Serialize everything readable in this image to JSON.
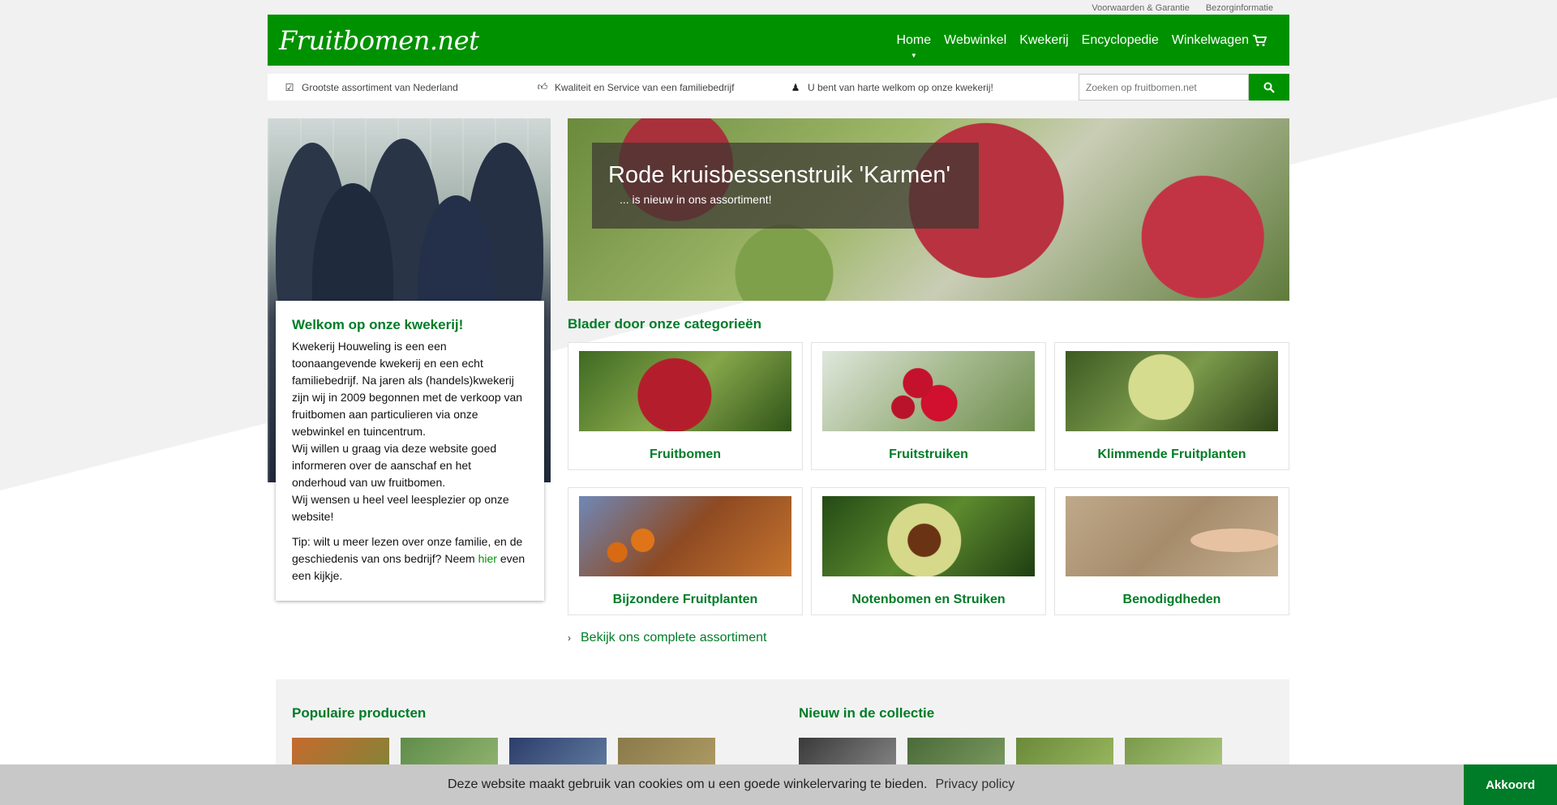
{
  "toplinks": [
    "Voorwaarden & Garantie",
    "Bezorginformatie"
  ],
  "header": {
    "logo": "Fruitbomen.net",
    "nav": [
      "Home",
      "Webwinkel",
      "Kwekerij",
      "Encyclopedie",
      "Winkelwagen"
    ],
    "active": "Home"
  },
  "usps": [
    {
      "icon": "check-icon",
      "text": "Grootste assortiment van Nederland"
    },
    {
      "icon": "thumbs-up-icon",
      "text": "Kwaliteit en Service van een familiebedrijf"
    },
    {
      "icon": "people-icon",
      "text": "U bent van harte welkom op onze kwekerij!"
    }
  ],
  "search": {
    "placeholder": "Zoeken op fruitbomen.net"
  },
  "welcome": {
    "title": "Welkom op onze kwekerij!",
    "p1": "Kwekerij Houweling is een een toonaangevende kwekerij en een echt familiebedrijf. Na jaren als (handels)kwekerij zijn wij in 2009 begonnen met de verkoop van fruitbomen aan particulieren via onze webwinkel en tuincentrum.",
    "p2": "Wij willen u graag via deze website goed informeren over de aanschaf en het onderhoud van uw fruitbomen.",
    "p3": "Wij wensen u heel veel leesplezier op onze website!",
    "tip_before": "Tip: wilt u meer lezen over onze familie, en de geschiedenis van ons bedrijf? Neem ",
    "tip_link": "hier",
    "tip_after": " even een kijkje."
  },
  "hero": {
    "title": "Rode kruisbessenstruik 'Karmen'",
    "subtitle": "... is nieuw in ons assortiment!"
  },
  "categories": {
    "title": "Blader door onze categorieën",
    "items": [
      "Fruitbomen",
      "Fruitstruiken",
      "Klimmende Fruitplanten",
      "Bijzondere Fruitplanten",
      "Notenbomen en Struiken",
      "Benodigdheden"
    ],
    "view_all": "Bekijk ons complete assortiment"
  },
  "bottom": {
    "popular_title": "Populaire producten",
    "new_title": "Nieuw in de collectie"
  },
  "cookie": {
    "message": "Deze website maakt gebruik van cookies om u een goede winkelervaring te bieden.",
    "policy": "Privacy policy",
    "accept": "Akkoord"
  },
  "colors": {
    "brand_green": "#009100",
    "text_green": "#007c28"
  }
}
